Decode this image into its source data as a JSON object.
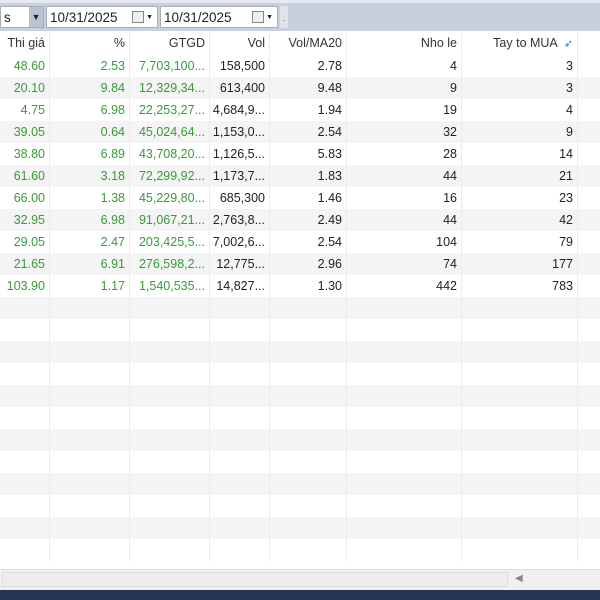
{
  "toolbar": {
    "filter_value": "s",
    "date_from": "10/31/2025",
    "date_to": "10/31/2025"
  },
  "columns": [
    "Thi giá",
    "%",
    "GTGD",
    "Vol",
    "Vol/MA20",
    "Nho le",
    "Tay to MUA"
  ],
  "rows": [
    [
      "48.60",
      "2.53",
      "7,703,100...",
      "158,500",
      "2.78",
      "4",
      "3"
    ],
    [
      "20.10",
      "9.84",
      "12,329,34...",
      "613,400",
      "9.48",
      "9",
      "3"
    ],
    [
      "4.75",
      "6.98",
      "22,253,27...",
      "4,684,9...",
      "1.94",
      "19",
      "4"
    ],
    [
      "39.05",
      "0.64",
      "45,024,64...",
      "1,153,0...",
      "2.54",
      "32",
      "9"
    ],
    [
      "38.80",
      "6.89",
      "43,708,20...",
      "1,126,5...",
      "5.83",
      "28",
      "14"
    ],
    [
      "61.60",
      "3.18",
      "72,299,92...",
      "1,173,7...",
      "1.83",
      "44",
      "21"
    ],
    [
      "66.00",
      "1.38",
      "45,229,80...",
      "685,300",
      "1.46",
      "16",
      "23"
    ],
    [
      "32.95",
      "6.98",
      "91,067,21...",
      "2,763,8...",
      "2.49",
      "44",
      "42"
    ],
    [
      "29.05",
      "2.47",
      "203,425,5...",
      "7,002,6...",
      "2.54",
      "104",
      "79"
    ],
    [
      "21.65",
      "6.91",
      "276,598,2...",
      "12,775...",
      "2.96",
      "74",
      "177"
    ],
    [
      "103.90",
      "1.17",
      "1,540,535...",
      "14,827...",
      "1.30",
      "442",
      "783"
    ]
  ],
  "colors": {
    "up": "#3a9a3a",
    "footer": "#283552"
  }
}
